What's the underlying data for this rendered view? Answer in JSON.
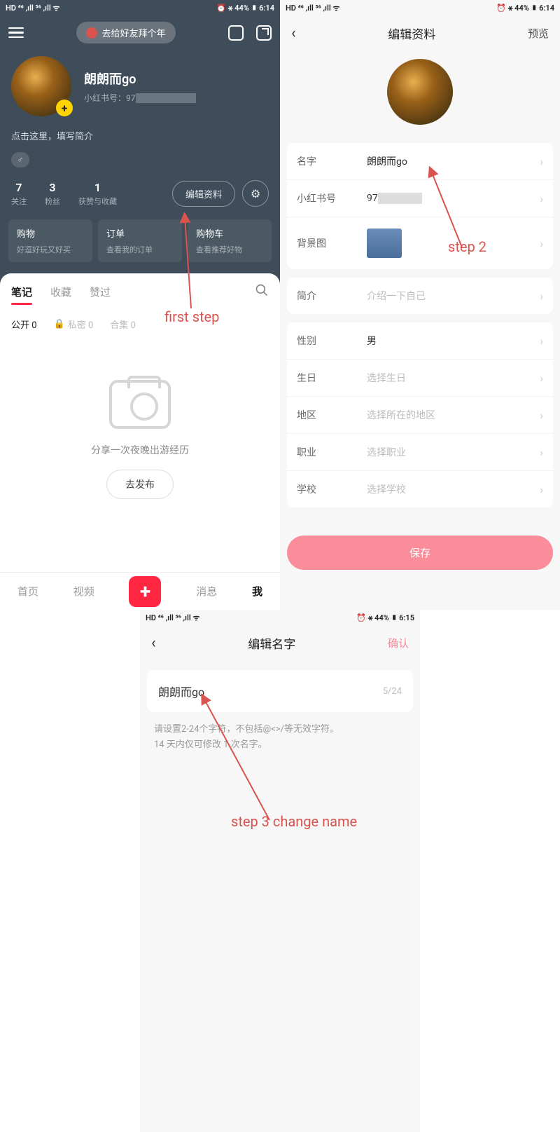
{
  "status": {
    "left": "HD ⁴⁶ ,ıll ⁵⁶ ,ıll ᯤ",
    "right_1": "⏰ ⚹ 44% ▮ 6:14",
    "right_2": "⏰ ⚹ 44% ▮ 6:15"
  },
  "left": {
    "banner": "去给好友拜个年",
    "name": "朗朗而go",
    "id_label": "小红书号：",
    "id_val": "97",
    "bio": "点击这里，填写简介",
    "stats": [
      {
        "n": "7",
        "l": "关注"
      },
      {
        "n": "3",
        "l": "粉丝"
      },
      {
        "n": "1",
        "l": "获赞与收藏"
      }
    ],
    "edit": "编辑资料",
    "cards": [
      {
        "t": "购物",
        "s": "好逗好玩又好买"
      },
      {
        "t": "订单",
        "s": "查看我的订单"
      },
      {
        "t": "购物车",
        "s": "查看推荐好物"
      }
    ],
    "tabs": [
      "笔记",
      "收藏",
      "赞过"
    ],
    "sub": {
      "open": "公开 0",
      "priv": "私密 0",
      "set": "合集 0"
    },
    "empty_text": "分享一次夜晚出游经历",
    "publish": "去发布",
    "nav": [
      "首页",
      "视频",
      "消息",
      "我"
    ]
  },
  "right": {
    "title": "编辑资料",
    "preview": "预览",
    "rows": {
      "name": {
        "l": "名字",
        "v": "朗朗而go"
      },
      "id": {
        "l": "小红书号",
        "v": "97"
      },
      "bg": {
        "l": "背景图"
      },
      "bio": {
        "l": "简介",
        "v": "介绍一下自己"
      },
      "gender": {
        "l": "性别",
        "v": "男"
      },
      "bday": {
        "l": "生日",
        "v": "选择生日"
      },
      "region": {
        "l": "地区",
        "v": "选择所在的地区"
      },
      "job": {
        "l": "职业",
        "v": "选择职业"
      },
      "school": {
        "l": "学校",
        "v": "选择学校"
      }
    },
    "save": "保存"
  },
  "mid": {
    "title": "编辑名字",
    "confirm": "确认",
    "value": "朗朗而go",
    "count": "5/24",
    "hint1": "请设置2-24个字符，不包括@<>/等无效字符。",
    "hint2": "14 天内仅可修改 1 次名字。"
  },
  "ann": {
    "s1": "first step",
    "s2": "step 2",
    "s3": "step 3  change name"
  }
}
